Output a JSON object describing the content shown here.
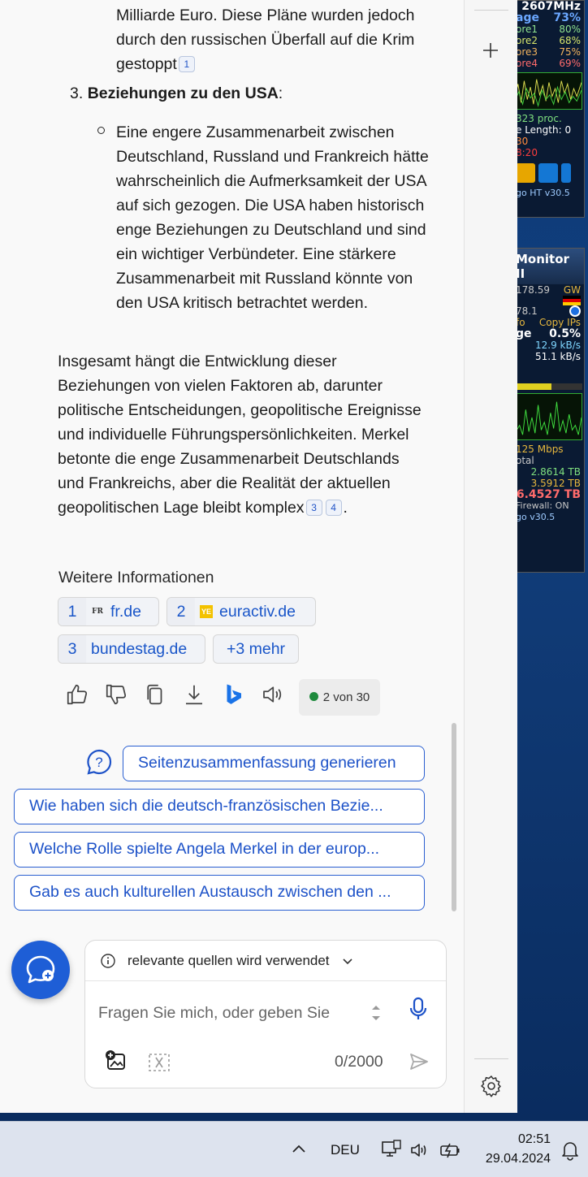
{
  "desktop": {
    "widget_cpu": {
      "freq": "2607MHz",
      "usage_label": "age",
      "usage_value": "73%",
      "cores": [
        {
          "label": "ore1",
          "value": "80%"
        },
        {
          "label": "ore2",
          "value": "68%"
        },
        {
          "label": "ore3",
          "value": "75%"
        },
        {
          "label": "ore4",
          "value": "69%"
        }
      ],
      "proc": "323 proc.",
      "queue": "e Length: 0",
      "line_a": "30",
      "line_b": "8:20",
      "footer": "go HT v30.5"
    },
    "widget_net": {
      "title": "Monitor II",
      "row1_value": "178.59",
      "row1_unit": "GW",
      "row2_value": "78.1",
      "row3_left": "fo",
      "row3_right": "Copy IPs",
      "usage_label": "ge",
      "usage_value": "0.5%",
      "up": "12.9 kB/s",
      "down": "51.1 kB/s",
      "speed": "125 Mbps",
      "total_label": "otal",
      "total1": "2.8614 TB",
      "total2": "3.5912 TB",
      "total3": "6.4527 TB",
      "firewall": "Firewall: ON",
      "footer": "go v30.5"
    }
  },
  "chat": {
    "paragraph_top": "Milliarde Euro. Diese Pläne wurden jedoch durch den russischen Überfall auf die Krim gestoppt",
    "paragraph_top_ref": "1",
    "item3_number": "3.",
    "item3_heading": "Beziehungen zu den USA",
    "item3_colon": ":",
    "item3_bullet": "Eine engere Zusammenarbeit zwischen Deutschland, Russland und Frankreich hätte wahrscheinlich die Aufmerksamkeit der USA auf sich gezogen. Die USA haben historisch enge Beziehungen zu Deutschland und sind ein wichtiger Verbündeter. Eine stärkere Zusammenarbeit mit Russland könnte von den USA kritisch betrachtet werden.",
    "summary": "Insgesamt hängt die Entwicklung dieser Beziehungen von vielen Faktoren ab, darunter politische Entscheidungen, geopolitische Ereignisse und individuelle Führungspersönlichkeiten. Merkel betonte die enge Zusammenarbeit Deutschlands und Frankreichs, aber die Realität der aktuellen geopolitischen Lage bleibt komplex",
    "summary_refs": [
      "3",
      "4"
    ],
    "summary_end": ".",
    "more_info_title": "Weitere Informationen",
    "sources": [
      {
        "num": "1",
        "label": "fr.de",
        "favicon": "FR"
      },
      {
        "num": "2",
        "label": "euractiv.de",
        "favicon": "YE"
      },
      {
        "num": "3",
        "label": "bundestag.de",
        "favicon": ""
      }
    ],
    "more_sources": "+3 mehr",
    "response_counter": "2 von 30",
    "suggestions": {
      "summary_button": "Seitenzusammenfassung generieren",
      "items": [
        "Wie haben sich die deutsch-französischen Bezie...",
        "Welche Rolle spielte Angela Merkel in der europ...",
        "Gab es auch kulturellen Austausch zwischen den ..."
      ]
    },
    "input": {
      "context_label": "relevante quellen wird verwendet",
      "placeholder": "Fragen Sie mich, oder geben Sie",
      "char_count": "0/2000"
    }
  },
  "taskbar": {
    "language": "DEU",
    "time": "02:51",
    "date": "29.04.2024"
  }
}
